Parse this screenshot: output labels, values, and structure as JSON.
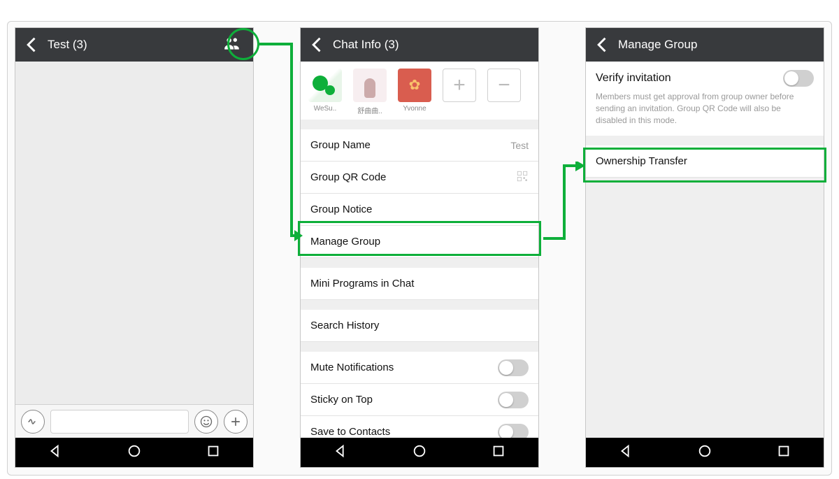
{
  "chat": {
    "title": "Test (3)"
  },
  "info": {
    "title": "Chat Info (3)",
    "members": [
      {
        "name": "WeSu.."
      },
      {
        "name": "舒曲曲.."
      },
      {
        "name": "Yvonne"
      }
    ],
    "rows": {
      "group_name_label": "Group Name",
      "group_name_value": "Test",
      "qr_label": "Group QR Code",
      "notice_label": "Group Notice",
      "manage_label": "Manage Group",
      "mini_label": "Mini Programs in Chat",
      "search_label": "Search History",
      "mute_label": "Mute Notifications",
      "sticky_label": "Sticky on Top",
      "save_label": "Save to Contacts"
    }
  },
  "manage": {
    "title": "Manage Group",
    "verify_label": "Verify invitation",
    "verify_desc": "Members must get approval from group owner before sending an invitation. Group QR Code will also be disabled in this mode.",
    "ownership_label": "Ownership Transfer"
  }
}
